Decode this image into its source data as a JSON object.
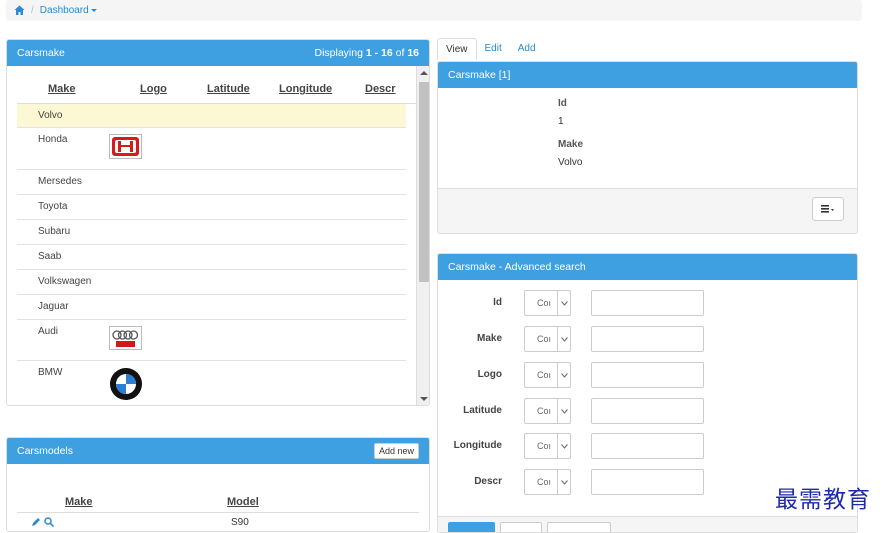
{
  "breadcrumb": {
    "home_icon": "home-icon",
    "current": "Dashboard"
  },
  "carsmake": {
    "title": "Carsmake",
    "displaying_prefix": "Displaying ",
    "range": "1 - 16",
    "of_word": " of ",
    "total": "16",
    "columns": [
      "Make",
      "Logo",
      "Latitude",
      "Longitude",
      "Descr"
    ],
    "rows": [
      {
        "make": "Volvo",
        "logo": ""
      },
      {
        "make": "Honda",
        "logo": "honda-logo"
      },
      {
        "make": "Mersedes",
        "logo": ""
      },
      {
        "make": "Toyota",
        "logo": ""
      },
      {
        "make": "Subaru",
        "logo": ""
      },
      {
        "make": "Saab",
        "logo": ""
      },
      {
        "make": "Volkswagen",
        "logo": ""
      },
      {
        "make": "Jaguar",
        "logo": ""
      },
      {
        "make": "Audi",
        "logo": "audi-logo"
      },
      {
        "make": "BMW",
        "logo": "bmw-logo"
      }
    ]
  },
  "carsmodels": {
    "title": "Carsmodels",
    "add_new": "Add new",
    "columns": [
      "Make",
      "Model"
    ],
    "rows": [
      {
        "model": "S90"
      }
    ]
  },
  "tabs": [
    "View",
    "Edit",
    "Add"
  ],
  "view": {
    "title": "Carsmake [1]",
    "id_label": "Id",
    "id_value": "1",
    "make_label": "Make",
    "make_value": "Volvo"
  },
  "search": {
    "title": "Carsmake - Advanced search",
    "fields": [
      "Id",
      "Make",
      "Logo",
      "Latitude",
      "Longitude",
      "Descr"
    ],
    "operator_display": "Coı"
  },
  "watermark": "最需教育",
  "colors": {
    "accent": "#3ea0e0",
    "selected_row": "#fcf8d3",
    "link": "#2a8bd1"
  }
}
